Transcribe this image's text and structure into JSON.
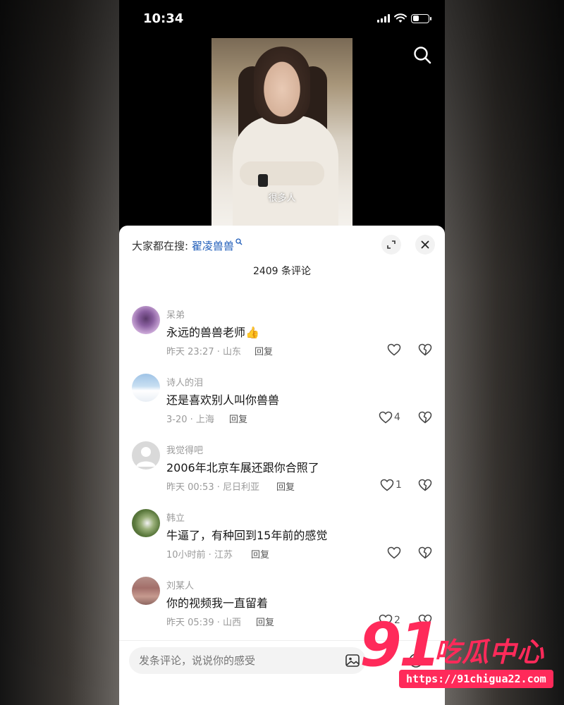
{
  "status_bar": {
    "time": "10:34"
  },
  "video": {
    "caption": "很多人"
  },
  "sheet": {
    "hot_search_label": "大家都在搜: ",
    "hot_search_keyword": "翟凌兽兽",
    "comment_count": "2409 条评论"
  },
  "comments": [
    {
      "user": "呆弟",
      "text": "永远的兽兽老师👍",
      "meta": "昨天 23:27 · 山东",
      "reply": "回复",
      "likes": ""
    },
    {
      "user": "诗人的泪",
      "text": "还是喜欢别人叫你兽兽",
      "meta": "3-20 · 上海",
      "reply": "回复",
      "likes": "4"
    },
    {
      "user": "我觉得吧",
      "text": "2006年北京车展还跟你合照了",
      "meta": "昨天 00:53 · 尼日利亚",
      "reply": "回复",
      "likes": "1"
    },
    {
      "user": "韩立",
      "text": "牛逼了，有种回到15年前的感觉",
      "meta": "10小时前 · 江苏",
      "reply": "回复",
      "likes": ""
    },
    {
      "user": "刘某人",
      "text": "你的视频我一直留着",
      "meta": "昨天 05:39 · 山西",
      "reply": "回复",
      "likes": "2"
    }
  ],
  "input": {
    "placeholder": "发条评论，说说你的感受"
  },
  "watermark": {
    "number": "91",
    "title": "吃瓜中心",
    "url": "https://91chigua22.com"
  },
  "colors": {
    "accent": "#1d5bb8",
    "watermark": "#ff2a5a"
  }
}
